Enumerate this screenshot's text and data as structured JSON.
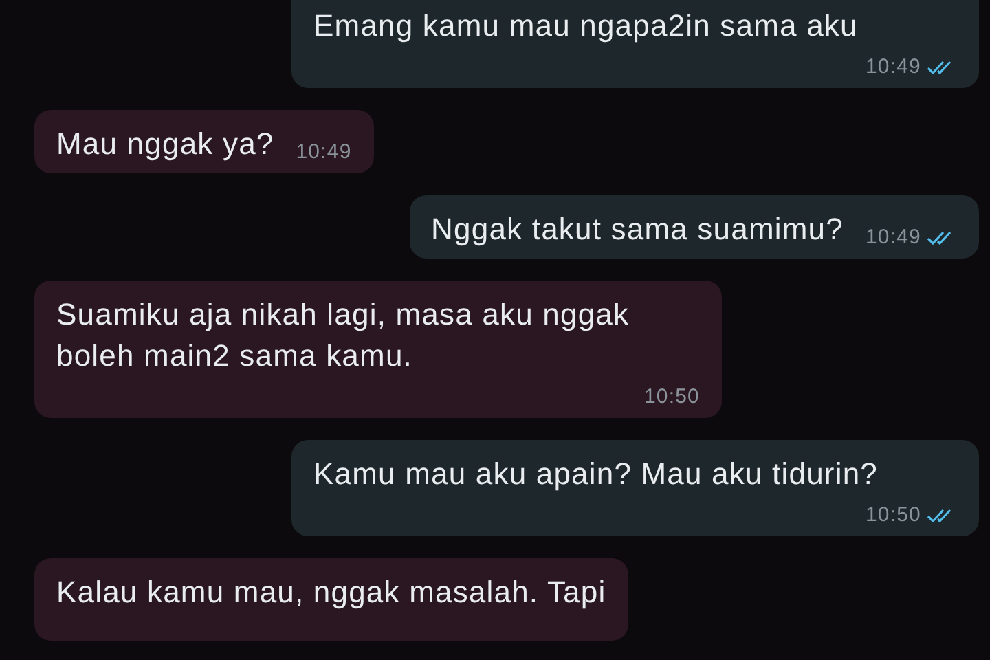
{
  "messages": [
    {
      "kind": "outgoing",
      "text": "Emang kamu mau ngapa2in sama aku",
      "time": "10:49",
      "read": true
    },
    {
      "kind": "incoming",
      "text": "Mau nggak ya?",
      "time": "10:49"
    },
    {
      "kind": "outgoing",
      "text": "Nggak takut sama suamimu?",
      "time": "10:49",
      "read": true
    },
    {
      "kind": "incoming",
      "text": "Suamiku aja nikah lagi, masa aku nggak boleh main2 sama kamu.",
      "time": "10:50"
    },
    {
      "kind": "outgoing",
      "text": "Kamu mau aku apain? Mau aku tidurin?",
      "time": "10:50",
      "read": true
    },
    {
      "kind": "incoming",
      "text": "Kalau kamu mau, nggak masalah. Tapi"
    }
  ]
}
